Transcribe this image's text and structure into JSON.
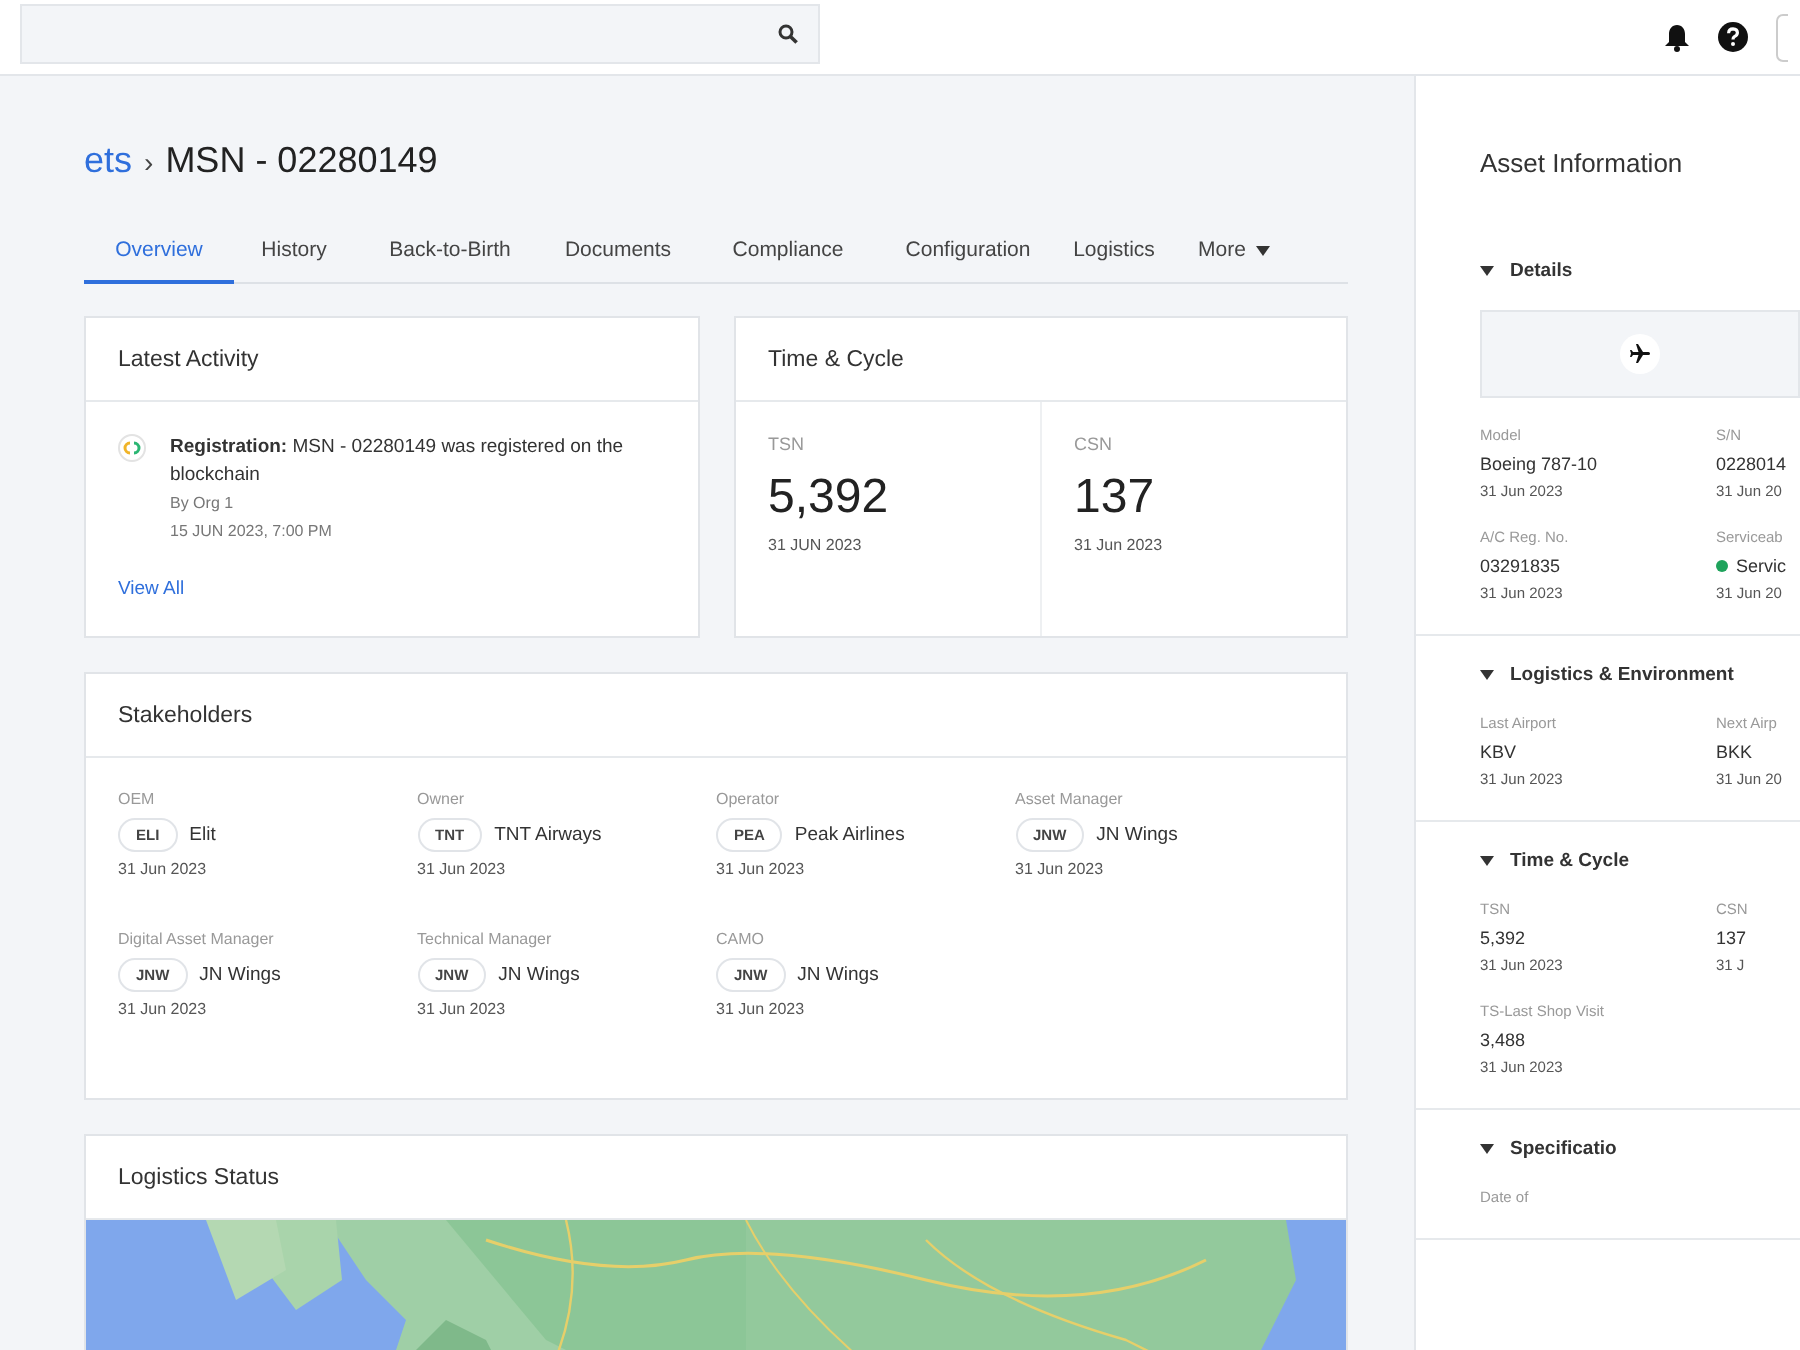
{
  "breadcrumb": {
    "parent": "ets",
    "separator": "›",
    "current": "MSN - 02280149"
  },
  "tabs": [
    {
      "label": "Overview",
      "selected": true,
      "dropdown": false
    },
    {
      "label": "History",
      "selected": false,
      "dropdown": false
    },
    {
      "label": "Back-to-Birth",
      "selected": false,
      "dropdown": false
    },
    {
      "label": "Documents",
      "selected": false,
      "dropdown": false
    },
    {
      "label": "Compliance",
      "selected": false,
      "dropdown": false
    },
    {
      "label": "Configuration",
      "selected": false,
      "dropdown": false
    },
    {
      "label": "Logistics",
      "selected": false,
      "dropdown": false
    },
    {
      "label": "More",
      "selected": false,
      "dropdown": true
    }
  ],
  "latest_activity": {
    "title": "Latest Activity",
    "items": [
      {
        "text": "**Registration:** MSN - 02280149 was registered on the blockchain",
        "by": "By Org 1",
        "time": "15 JUN 2023, 7:00 PM"
      }
    ],
    "link": "View All"
  },
  "time_cycle": {
    "title": "Time & Cycle",
    "metrics": [
      {
        "label": "TSN",
        "value": "5,392",
        "date": "31 JUN 2023"
      },
      {
        "label": "CSN",
        "value": "137",
        "date": "31 Jun 2023"
      }
    ]
  },
  "stakeholders": {
    "title": "Stakeholders",
    "items": [
      {
        "role": "OEM",
        "code": "ELI",
        "name": "Elit",
        "date": "31 Jun 2023"
      },
      {
        "role": "Owner",
        "code": "TNT",
        "name": "TNT Airways",
        "date": "31 Jun 2023"
      },
      {
        "role": "Operator",
        "code": "PEA",
        "name": "Peak Airlines",
        "date": "31 Jun 2023"
      },
      {
        "role": "Asset Manager",
        "code": "JNW",
        "name": "JN Wings",
        "date": "31 Jun 2023"
      },
      {
        "role": "Digital Asset Manager",
        "code": "JNW",
        "name": "JN Wings",
        "date": "31 Jun 2023"
      },
      {
        "role": "Technical Manager",
        "code": "JNW",
        "name": "JN Wings",
        "date": "31 Jun 2023"
      },
      {
        "role": "CAMO",
        "code": "JNW",
        "name": "JN Wings",
        "date": "31 Jun 2023"
      }
    ]
  },
  "logistics_status": {
    "title": "Logistics Status"
  },
  "asset_information": {
    "title": "Asset Information",
    "sections": [
      {
        "title": "Details",
        "expanded": true,
        "has_image": true,
        "fields": [
          {
            "label": "Model",
            "value": "Boeing 787-10",
            "date": "31 Jun 2023"
          },
          {
            "label": "S/N",
            "value": "0228014",
            "date": "31 Jun 20"
          },
          {
            "label": "A/C Reg. No.",
            "value": "03291835",
            "date": "31 Jun 2023"
          },
          {
            "label": "Serviceab",
            "value": "Servic",
            "date": "31 Jun 20",
            "color": "#1fa35c"
          }
        ]
      },
      {
        "title": "Logistics & Environment",
        "expanded": true,
        "has_image": false,
        "fields": [
          {
            "label": "Last Airport",
            "value": "KBV",
            "date": "31 Jun 2023"
          },
          {
            "label": "Next Airp",
            "value": "BKK",
            "date": "31 Jun 20"
          }
        ]
      },
      {
        "title": "Time & Cycle",
        "expanded": true,
        "has_image": false,
        "fields": [
          {
            "label": "TSN",
            "value": "5,392",
            "date": "31 Jun 2023"
          },
          {
            "label": "CSN",
            "value": "137",
            "date": "31 J"
          },
          {
            "label": "TS-Last Shop Visit",
            "value": "3,488",
            "date": "31 Jun 2023"
          }
        ]
      },
      {
        "title": "Specificatio",
        "expanded": true,
        "has_image": false,
        "fields": [
          {
            "label": "Date of"
          }
        ]
      }
    ]
  }
}
